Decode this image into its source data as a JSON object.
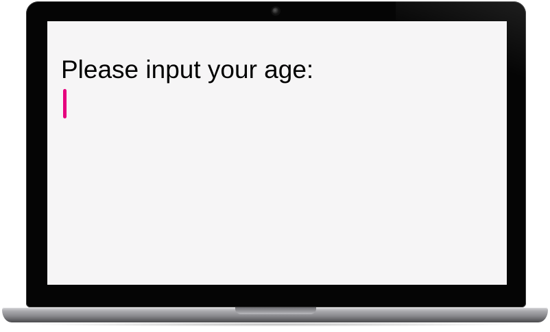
{
  "screen": {
    "prompt_text": "Please input your age:",
    "age_input": {
      "value": "",
      "placeholder": ""
    }
  },
  "colors": {
    "caret": "#e6007e",
    "screen_background": "#f6f5f6",
    "bezel": "#050505",
    "text": "#000000"
  },
  "icons": {
    "camera": "webcam-icon"
  }
}
